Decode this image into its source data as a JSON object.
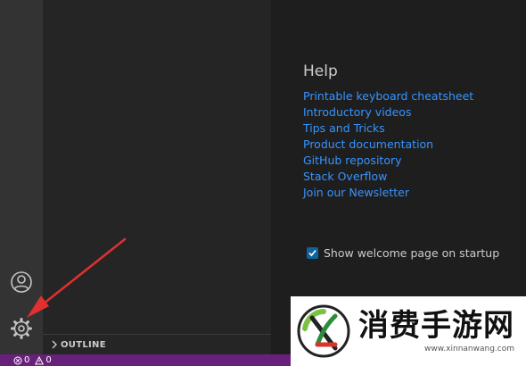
{
  "activity_bar": {
    "icons": [
      "account-icon",
      "gear-icon"
    ]
  },
  "sidebar": {
    "outline_label": "OUTLINE"
  },
  "welcome": {
    "help_title": "Help",
    "help_links": [
      "Printable keyboard cheatsheet",
      "Introductory videos",
      "Tips and Tricks",
      "Product documentation",
      "GitHub repository",
      "Stack Overflow",
      "Join our Newsletter"
    ],
    "show_on_startup_label": "Show welcome page on startup",
    "show_on_startup_checked": true
  },
  "statusbar": {
    "errors": "0",
    "warnings": "0"
  },
  "watermark": {
    "title": "消费手游网",
    "url": "www.xinnanwang.com"
  },
  "colors": {
    "activity_bar": "#333333",
    "sidebar": "#252526",
    "editor": "#1e1e1e",
    "statusbar": "#68217a",
    "link": "#3794ff",
    "annotation_arrow": "#e03030"
  }
}
